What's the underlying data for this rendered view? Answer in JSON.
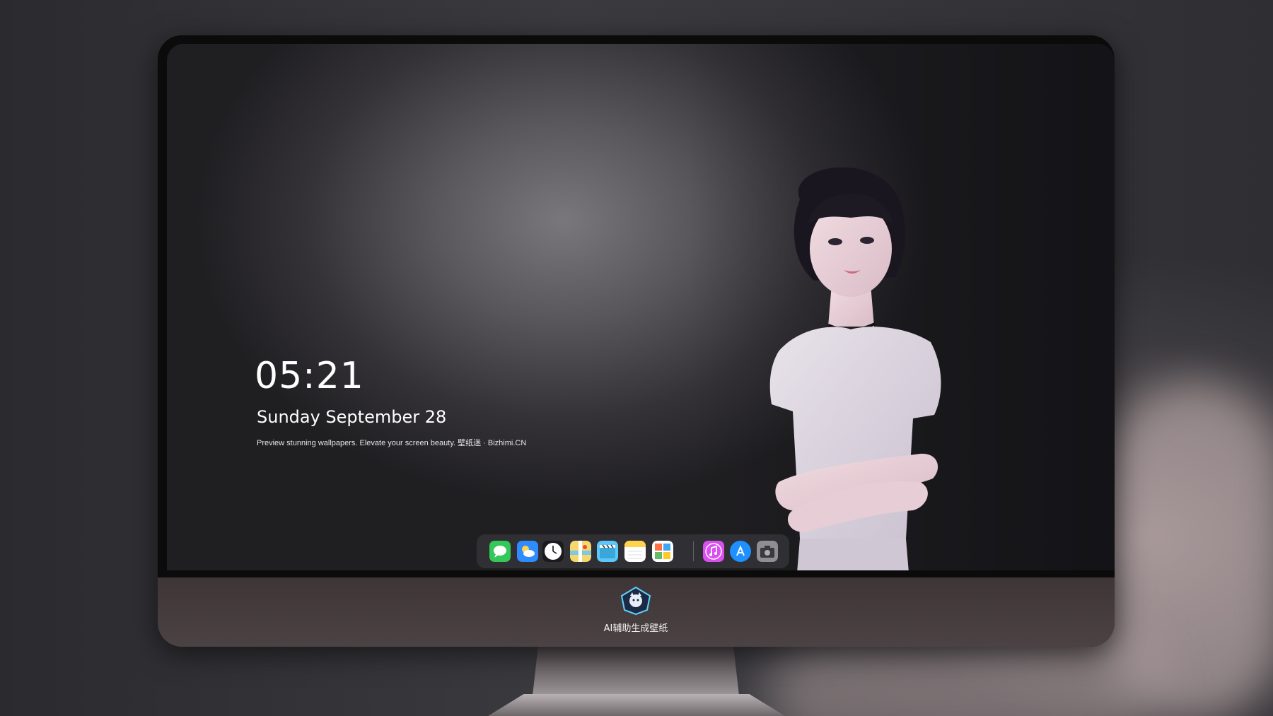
{
  "desktop": {
    "clock": {
      "time": "05:21",
      "date": "Sunday September  28"
    },
    "tagline": "Preview stunning wallpapers. Elevate your screen beauty. 壁纸迷 · Bizhimi.CN"
  },
  "dock": {
    "apps": [
      {
        "name": "messages-icon",
        "color": "#34c759"
      },
      {
        "name": "weather-icon",
        "color": "#2f8cff"
      },
      {
        "name": "clock-icon",
        "color": "#ffffff"
      },
      {
        "name": "maps-icon",
        "color": "#f5d76e"
      },
      {
        "name": "clips-icon",
        "color": "#5ac8fa"
      },
      {
        "name": "notes-icon",
        "color": "#ffd34d"
      },
      {
        "name": "photos-icon",
        "color": "#8bc34a"
      },
      {
        "name": "itunes-icon",
        "color": "#d94ff0"
      },
      {
        "name": "app-store-icon",
        "color": "#1e90ff"
      },
      {
        "name": "camera-icon",
        "color": "#8e8e93"
      }
    ]
  },
  "monitor": {
    "chin_caption": "AI辅助生成壁纸"
  }
}
